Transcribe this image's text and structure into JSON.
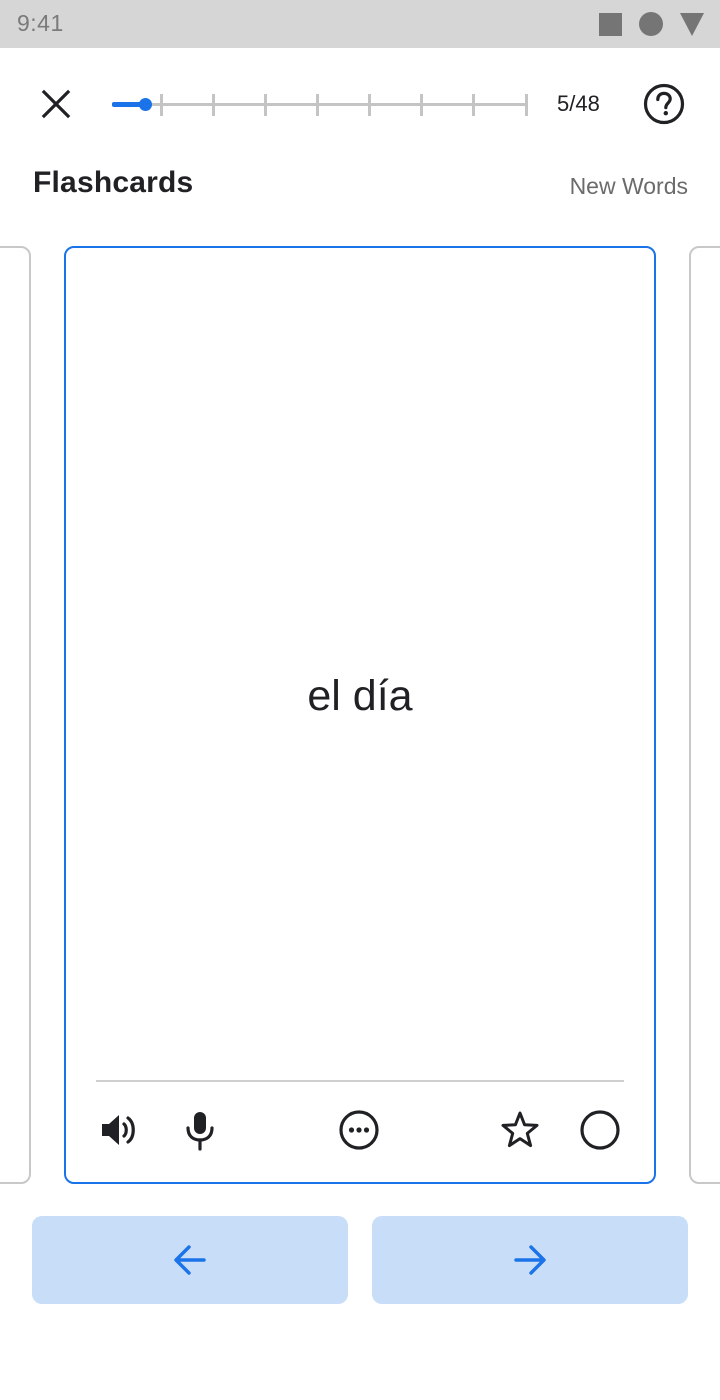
{
  "status_bar": {
    "time": "9:41",
    "icons": [
      "square-icon",
      "circle-icon",
      "triangle-down-icon"
    ]
  },
  "header": {
    "close_icon": "close-icon",
    "progress": {
      "current": 5,
      "total": 48,
      "label": "5/48",
      "fraction": 0.104
    },
    "help_icon": "help-circle-icon"
  },
  "title_row": {
    "title": "Flashcards",
    "deck": "New Words"
  },
  "card": {
    "word": "el día",
    "tools": [
      "speaker-icon",
      "microphone-icon",
      "more-options-icon",
      "star-outline-icon",
      "circle-outline-icon"
    ]
  },
  "navigation": {
    "previous_icon": "arrow-left-icon",
    "next_icon": "arrow-right-icon"
  },
  "colors": {
    "accent": "#1a73e8",
    "nav_button_bg": "#c8ddf8",
    "text_primary": "#202124",
    "text_secondary": "#6b6b6b",
    "status_bar": "#d6d6d6"
  }
}
